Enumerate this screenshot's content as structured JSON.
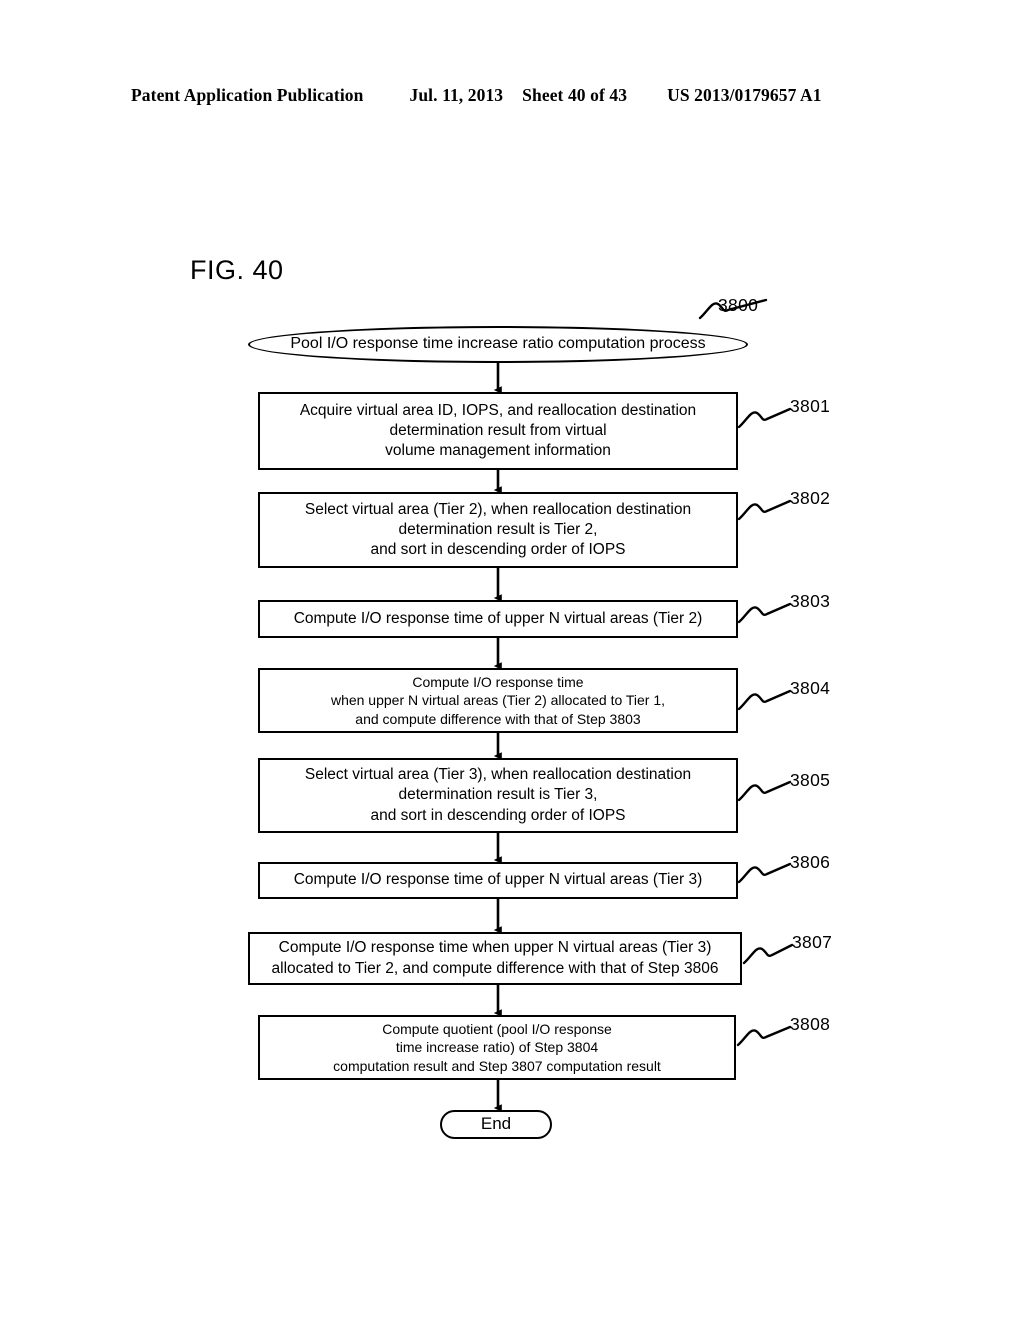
{
  "header": {
    "publication": "Patent Application Publication",
    "date": "Jul. 11, 2013",
    "sheet": "Sheet 40 of 43",
    "pub_number": "US 2013/0179657 A1"
  },
  "figure": {
    "label": "FIG. 40",
    "top_ref": "3800"
  },
  "flowchart": {
    "start": {
      "ref": "3800",
      "text": "Pool I/O response time increase ratio computation process"
    },
    "steps": [
      {
        "ref": "3801",
        "lines": [
          "Acquire virtual area ID, IOPS, and reallocation destination",
          "determination result from virtual",
          "volume management information"
        ]
      },
      {
        "ref": "3802",
        "lines": [
          "Select virtual area (Tier 2), when reallocation destination",
          "determination result is Tier 2,",
          "and sort in descending order of IOPS"
        ]
      },
      {
        "ref": "3803",
        "lines": [
          "Compute I/O response time of upper N virtual areas (Tier 2)"
        ]
      },
      {
        "ref": "3804",
        "lines": [
          "Compute I/O response time",
          "when upper N virtual areas (Tier 2) allocated to Tier 1,",
          "and compute difference with that of Step 3803"
        ]
      },
      {
        "ref": "3805",
        "lines": [
          "Select virtual area (Tier 3), when reallocation destination",
          "determination result is Tier 3,",
          "and sort in descending order of IOPS"
        ]
      },
      {
        "ref": "3806",
        "lines": [
          "Compute I/O response time of upper N virtual areas (Tier 3)"
        ]
      },
      {
        "ref": "3807",
        "lines": [
          "Compute I/O response time when upper N virtual areas (Tier 3)",
          "allocated to Tier 2, and compute difference with that of Step 3806"
        ]
      },
      {
        "ref": "3808",
        "lines": [
          "Compute quotient (pool I/O response",
          "time increase ratio) of Step 3804",
          "computation result and Step 3807 computation result"
        ]
      }
    ],
    "end": {
      "text": "End"
    }
  }
}
